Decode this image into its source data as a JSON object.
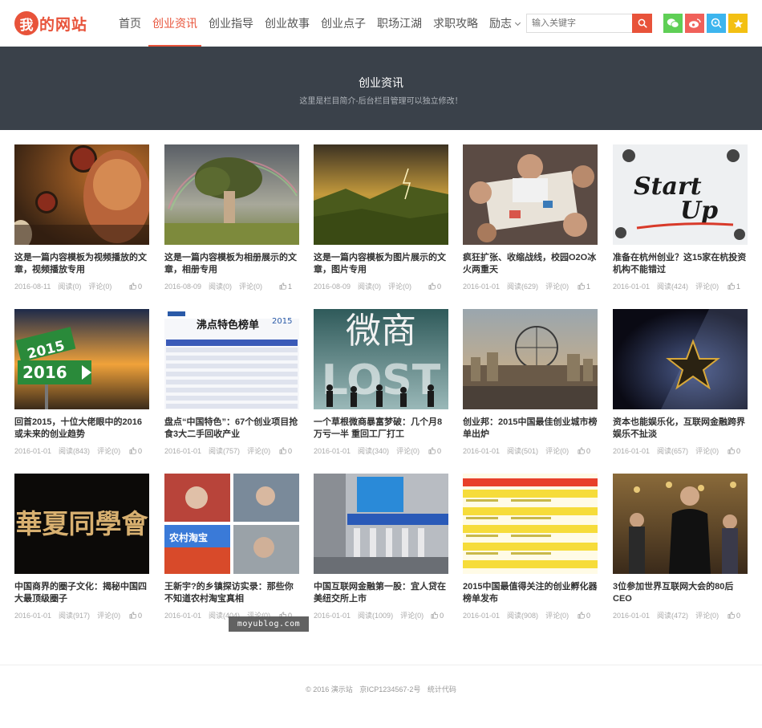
{
  "header": {
    "logo_mark": "我",
    "logo_text": "的网站",
    "nav": [
      {
        "label": "首页"
      },
      {
        "label": "创业资讯",
        "active": true
      },
      {
        "label": "创业指导"
      },
      {
        "label": "创业故事"
      },
      {
        "label": "创业点子"
      },
      {
        "label": "职场江湖"
      },
      {
        "label": "求职攻略"
      },
      {
        "label": "励志",
        "dropdown": true
      }
    ],
    "search_placeholder": "输入关键字",
    "search_icon": "search-icon",
    "social": [
      {
        "icon": "wechat-icon",
        "color": "#5fcf56"
      },
      {
        "icon": "weibo-icon",
        "color": "#f0615a"
      },
      {
        "icon": "qq-icon",
        "color": "#3db5ee"
      },
      {
        "icon": "star-icon",
        "color": "#f3c013"
      }
    ],
    "accent": "#e8533a"
  },
  "banner": {
    "title": "创业资讯",
    "subtitle": "这里是栏目简介-后台栏目管理可以独立修改！",
    "background": "#3a414a"
  },
  "posts": [
    {
      "title": "这是一篇内容模板为视频播放的文章，视频播放专用",
      "date": "2016-08-11",
      "views": "阅读(0)",
      "comments": "评论(0)",
      "likes": "0"
    },
    {
      "title": "这是一篇内容模板为相册展示的文章，相册专用",
      "date": "2016-08-09",
      "views": "阅读(0)",
      "comments": "评论(0)",
      "likes": "1"
    },
    {
      "title": "这是一篇内容模板为图片展示的文章，图片专用",
      "date": "2016-08-09",
      "views": "阅读(0)",
      "comments": "评论(0)",
      "likes": "0"
    },
    {
      "title": "疯狂扩张、收缩战线，校园O2O冰火两重天",
      "date": "2016-01-01",
      "views": "阅读(629)",
      "comments": "评论(0)",
      "likes": "1"
    },
    {
      "title": "准备在杭州创业？这15家在杭投资机构不能错过",
      "date": "2016-01-01",
      "views": "阅读(424)",
      "comments": "评论(0)",
      "likes": "1"
    },
    {
      "title": "回首2015，十位大佬眼中的2016或未来的创业趋势",
      "date": "2016-01-01",
      "views": "阅读(843)",
      "comments": "评论(0)",
      "likes": "0"
    },
    {
      "title": "盘点“中国特色”：67个创业项目抢食3大二手回收产业",
      "date": "2016-01-01",
      "views": "阅读(757)",
      "comments": "评论(0)",
      "likes": "0"
    },
    {
      "title": "一个草根微商暴富梦破：几个月8万亏一半 重回工厂打工",
      "date": "2016-01-01",
      "views": "阅读(340)",
      "comments": "评论(0)",
      "likes": "0"
    },
    {
      "title": "创业邦：2015中国最佳创业城市榜单出炉",
      "date": "2016-01-01",
      "views": "阅读(501)",
      "comments": "评论(0)",
      "likes": "0"
    },
    {
      "title": "资本也能娱乐化，互联网金融跨界娱乐不扯淡",
      "date": "2016-01-01",
      "views": "阅读(657)",
      "comments": "评论(0)",
      "likes": "0"
    },
    {
      "title": "中国商界的圈子文化：揭秘中国四大最顶级圈子",
      "date": "2016-01-01",
      "views": "阅读(917)",
      "comments": "评论(0)",
      "likes": "0"
    },
    {
      "title": "王新宇?的乡镇探访实录：那些你不知道农村淘宝真相",
      "date": "2016-01-01",
      "views": "阅读(404)",
      "comments": "评论(0)",
      "likes": "0"
    },
    {
      "title": "中国互联网金融第一股：宜人贷在美纽交所上市",
      "date": "2016-01-01",
      "views": "阅读(1009)",
      "comments": "评论(0)",
      "likes": "0"
    },
    {
      "title": "2015中国最值得关注的创业孵化器榜单发布",
      "date": "2016-01-01",
      "views": "阅读(908)",
      "comments": "评论(0)",
      "likes": "0"
    },
    {
      "title": "3位参加世界互联网大会的80后CEO",
      "date": "2016-01-01",
      "views": "阅读(472)",
      "comments": "评论(0)",
      "likes": "0"
    }
  ],
  "thumb_text": {
    "startup_start": "Start",
    "startup_up": "Up",
    "sign_2015": "2015",
    "sign_2016": "2016",
    "ranking_title": "沸点特色榜单",
    "ranking_year": "2015",
    "weishang": "微商",
    "lost": "LOST",
    "huaxia": "華夏同學會",
    "taobao": "农村淘宝"
  },
  "watermark": "moyublog.com",
  "footer": {
    "copyright": "© 2016 演示站",
    "icp": "京ICP1234567-2号",
    "stats": "统计代码"
  }
}
